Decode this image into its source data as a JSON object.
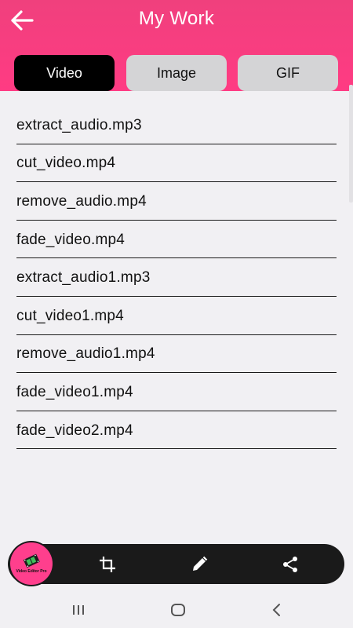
{
  "header": {
    "title": "My Work",
    "back_icon": "arrow-left-icon",
    "gradient_colors": [
      "#f0407d",
      "#ff3b83"
    ]
  },
  "tabs": [
    {
      "label": "Video",
      "active": true
    },
    {
      "label": "Image",
      "active": false
    },
    {
      "label": "GIF",
      "active": false
    }
  ],
  "files": [
    "extract_audio.mp3",
    "cut_video.mp4",
    "remove_audio.mp4",
    "fade_video.mp4",
    "extract_audio1.mp3",
    "cut_video1.mp4",
    "remove_audio1.mp4",
    "fade_video1.mp4",
    "fade_video2.mp4"
  ],
  "bottom_bar": {
    "app_badge_caption": "Video Editor Pro",
    "buttons": [
      "film-icon",
      "crop-icon",
      "pencil-icon",
      "share-icon"
    ],
    "accent_color": "#ff3f8d"
  },
  "system_nav": [
    "recents-icon",
    "home-icon",
    "back-chevron-icon"
  ]
}
